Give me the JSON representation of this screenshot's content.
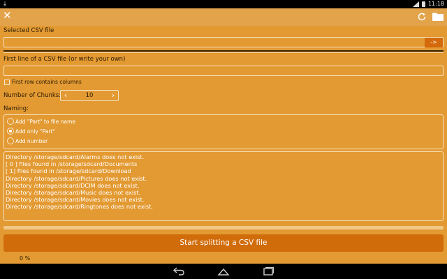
{
  "status_bar": {
    "notification_icon": "download-icon",
    "time": "11:18"
  },
  "action_bar": {
    "close_icon": "close-icon",
    "refresh_icon": "refresh-icon",
    "folder_icon": "folder-icon"
  },
  "form": {
    "selected_file_label": "Selected CSV file",
    "selected_file_value": "",
    "go_button_label": "->",
    "first_line_label": "First line of a CSV file (or write your own)",
    "first_line_value": "",
    "first_row_checkbox_label": "First row contains columns",
    "first_row_checked": false,
    "chunks_label": "Number of Chunks:",
    "chunks_value": "10",
    "naming_label": "Naming:",
    "naming_options": [
      {
        "label": "Add \"Part\" to file name",
        "checked": false
      },
      {
        "label": "Add only \"Part\"",
        "checked": true
      },
      {
        "label": "Add number",
        "checked": false
      }
    ]
  },
  "log": {
    "lines": [
      "Directory /storage/sdcard/Alarms does not exist.",
      "[ 0 ] files found in /storage/sdcard/Documents",
      "[ 1] files found in /storage/sdcard/Download",
      "Directory /storage/sdcard/Pictures does not exist.",
      "Directory /storage/sdcard/DCIM does not exist.",
      "Directory /storage/sdcard/Music does not exist.",
      "Directory /storage/sdcard/Movies does not exist.",
      "Directory /storage/sdcard/Ringtones does not exist."
    ]
  },
  "progress": {
    "fraction": 0,
    "percent_text": "0 %"
  },
  "start_button_label": "Start splitting a CSV file",
  "nav_bar": {
    "back_icon": "back-icon",
    "home_icon": "home-icon",
    "recents_icon": "recents-icon"
  },
  "colors": {
    "background": "#e39a32",
    "action_bar": "#e3a34a",
    "accent": "#d16c0a"
  }
}
